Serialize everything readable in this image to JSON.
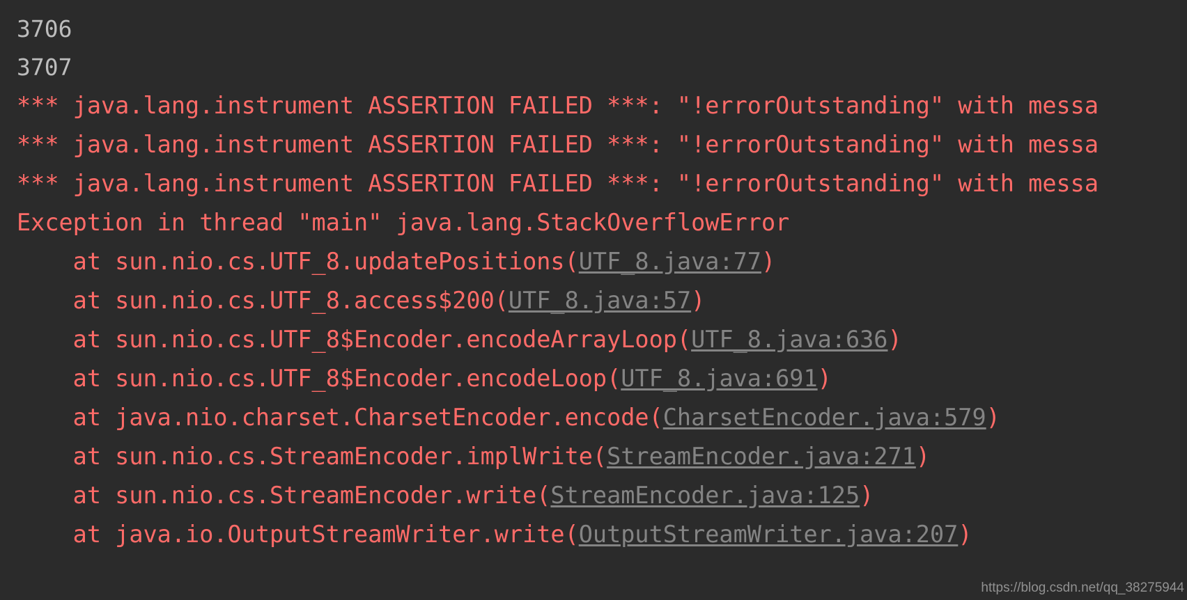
{
  "console": {
    "background_color": "#2b2b2b",
    "error_color": "#ff6b68",
    "link_color": "#848484",
    "lineno_color": "#bdbdbd",
    "lines": [
      {
        "kind": "lineno",
        "text": "3706"
      },
      {
        "kind": "lineno",
        "text": "3707"
      },
      {
        "kind": "error",
        "text": "*** java.lang.instrument ASSERTION FAILED ***: \"!errorOutstanding\" with messa"
      },
      {
        "kind": "error",
        "text": "*** java.lang.instrument ASSERTION FAILED ***: \"!errorOutstanding\" with messa"
      },
      {
        "kind": "error",
        "text": "*** java.lang.instrument ASSERTION FAILED ***: \"!errorOutstanding\" with messa"
      },
      {
        "kind": "error",
        "text": "Exception in thread \"main\" java.lang.StackOverflowError"
      },
      {
        "kind": "frame",
        "prefix": "    at sun.nio.cs.UTF_8.updatePositions(",
        "link": "UTF_8.java:77",
        "suffix": ")"
      },
      {
        "kind": "frame",
        "prefix": "    at sun.nio.cs.UTF_8.access$200(",
        "link": "UTF_8.java:57",
        "suffix": ")"
      },
      {
        "kind": "frame",
        "prefix": "    at sun.nio.cs.UTF_8$Encoder.encodeArrayLoop(",
        "link": "UTF_8.java:636",
        "suffix": ")"
      },
      {
        "kind": "frame",
        "prefix": "    at sun.nio.cs.UTF_8$Encoder.encodeLoop(",
        "link": "UTF_8.java:691",
        "suffix": ")"
      },
      {
        "kind": "frame",
        "prefix": "    at java.nio.charset.CharsetEncoder.encode(",
        "link": "CharsetEncoder.java:579",
        "suffix": ")"
      },
      {
        "kind": "frame",
        "prefix": "    at sun.nio.cs.StreamEncoder.implWrite(",
        "link": "StreamEncoder.java:271",
        "suffix": ")"
      },
      {
        "kind": "frame",
        "prefix": "    at sun.nio.cs.StreamEncoder.write(",
        "link": "StreamEncoder.java:125",
        "suffix": ")"
      },
      {
        "kind": "frame",
        "prefix": "    at java.io.OutputStreamWriter.write(",
        "link": "OutputStreamWriter.java:207",
        "suffix": ")"
      }
    ]
  },
  "watermark": {
    "text": "https://blog.csdn.net/qq_38275944"
  }
}
